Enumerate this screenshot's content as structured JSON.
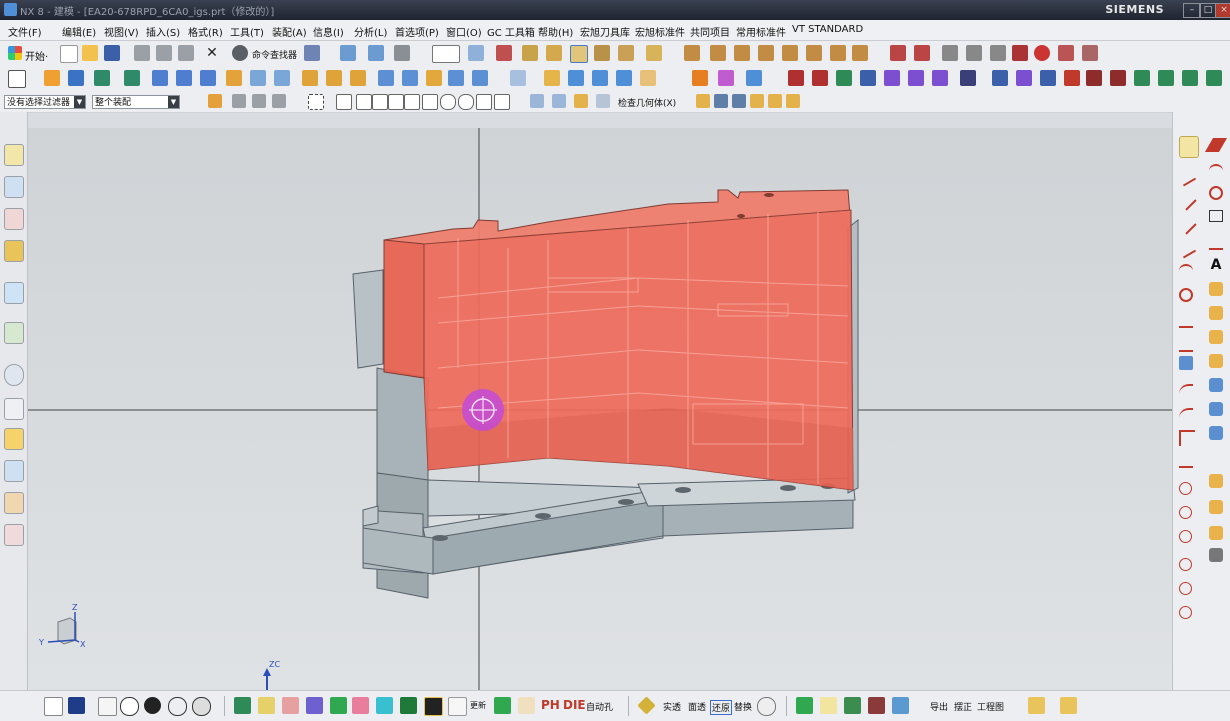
{
  "window": {
    "title": "NX 8 - 建模 - [EA20-678RPD_6CA0_igs.prt（修改的）]",
    "brand": "SIEMENS",
    "controls": [
      "–",
      "□",
      "×"
    ]
  },
  "menu": [
    "文件(F)",
    "编辑(E)",
    "视图(V)",
    "插入(S)",
    "格式(R)",
    "工具(T)",
    "装配(A)",
    "信息(I)",
    "分析(L)",
    "首选项(P)",
    "窗口(O)",
    "GC 工具箱",
    "帮助(H)",
    "宏旭刀具库",
    "宏旭标准件",
    "共同项目",
    "常用标准件",
    "VT STANDARD"
  ],
  "toolbar": {
    "start_label": "开始·",
    "command_finder": "命令查找器"
  },
  "selection_bar": {
    "filter_value": "没有选择过滤器",
    "assembly_value": "整个装配",
    "check_geometry": "检查几何体(X)"
  },
  "bottom": {
    "auto_hole": "自动孔",
    "labels": [
      "实透",
      "面透",
      "还原",
      "替换"
    ],
    "export": "导出",
    "align": "摆正",
    "drawing": "工程图",
    "die": "DIE",
    "ph": "PH",
    "update": "更新"
  },
  "triad": {
    "x": "X",
    "y": "Y",
    "z": "Z",
    "zc": "ZC"
  },
  "colors": {
    "cavity_plate": "#ef6b5b",
    "core_plate": "#a7b3b8",
    "selection_marker": "#c24ad8"
  }
}
